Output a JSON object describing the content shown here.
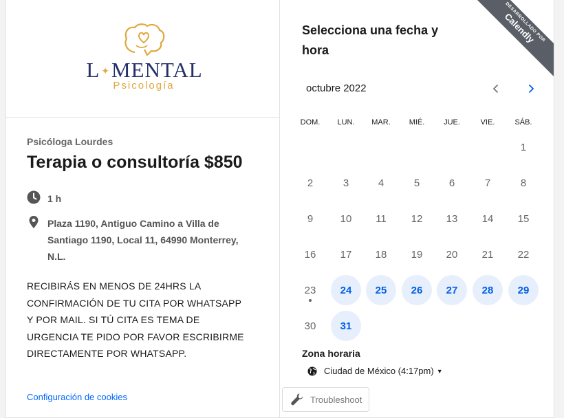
{
  "brand": {
    "logo_text_a": "L",
    "logo_text_b": "MENTAL",
    "logo_sub": "Psicología",
    "accent_gold": "#e0a73c",
    "navy": "#25306a"
  },
  "event": {
    "organizer": "Psicóloga Lourdes",
    "title": "Terapia o consultoría $850",
    "duration": "1 h",
    "location": [
      "Plaza 1190, Antiguo Camino a Villa de",
      "Santiago 1190, Local 11, 64990 Monterrey,",
      "N.L."
    ],
    "description": [
      "RECIBIRÁS EN MENOS DE 24HRS LA",
      "CONFIRMACIÓN DE TU CITA POR WHATSAPP",
      "Y POR MAIL. SI TÚ CITA ES TEMA DE",
      "URGENCIA TE PIDO POR FAVOR ESCRIBIRME",
      "DIRECTAMENTE POR WHATSAPP."
    ],
    "clock_icon": "clock-icon",
    "location_icon": "location-pin-icon"
  },
  "footer": {
    "cookies_link": "Configuración de cookies"
  },
  "scheduler": {
    "title_line1": "Selecciona una fecha y",
    "title_line2": "hora",
    "month": "octubre 2022",
    "weekdays": [
      "DOM.",
      "LUN.",
      "MAR.",
      "MIÉ.",
      "JUE.",
      "VIE.",
      "SÁB."
    ],
    "weeks": [
      [
        null,
        null,
        null,
        null,
        null,
        null,
        1
      ],
      [
        2,
        3,
        4,
        5,
        6,
        7,
        8
      ],
      [
        9,
        10,
        11,
        12,
        13,
        14,
        15
      ],
      [
        16,
        17,
        18,
        19,
        20,
        21,
        22
      ],
      [
        23,
        24,
        25,
        26,
        27,
        28,
        29
      ],
      [
        30,
        31,
        null,
        null,
        null,
        null,
        null
      ]
    ],
    "available_days": [
      24,
      25,
      26,
      27,
      28,
      29,
      31
    ],
    "today": 23,
    "timezone_label": "Zona horaria",
    "timezone_value": "Ciudad de México (4:17pm)",
    "available_color": "#0060e6"
  },
  "ribbon": {
    "line1": "DESARROLLADO POR",
    "line2": "Calendly"
  },
  "troubleshoot": {
    "label": "Troubleshoot"
  }
}
